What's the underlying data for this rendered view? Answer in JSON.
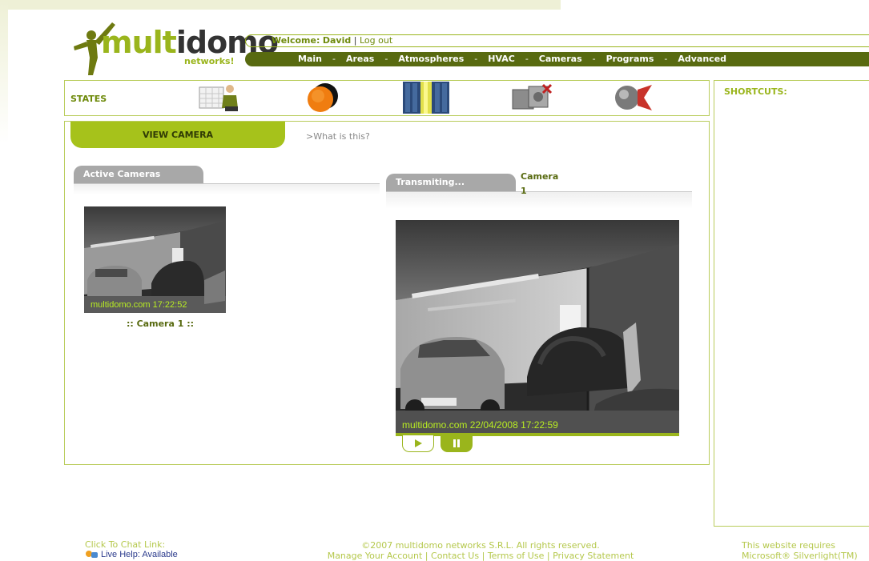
{
  "logo": {
    "part1": "mult",
    "part2": "idomo",
    "subtitle": "networks!"
  },
  "header": {
    "welcome_label": "Welcome:",
    "user_name": "David",
    "separator": "|",
    "logout": "Log out"
  },
  "nav": {
    "items": [
      "Main",
      "Areas",
      "Atmospheres",
      "HVAC",
      "Cameras",
      "Programs",
      "Advanced"
    ],
    "separator": "-"
  },
  "states": {
    "label": "STATES",
    "icons": [
      "calendar-person-icon",
      "sun-moon-icon",
      "blinds-icon",
      "projector-icon",
      "camera-globe-icon"
    ]
  },
  "shortcuts": {
    "label": "SHORTCUTS:"
  },
  "main": {
    "view_camera_tab": "VIEW CAMERA",
    "what_link": ">What is this?",
    "active_cameras_tab": "Active Cameras",
    "transmitting_tab": "Transmiting...",
    "camera_title_line1": "Camera",
    "camera_title_line2": "1",
    "thumb_stamp": "multidomo.com 17:22:52",
    "thumb_caption": ":: Camera 1 ::",
    "main_stamp": "multidomo.com 22/04/2008 17:22:59"
  },
  "footer": {
    "chat_label": "Click To Chat Link:",
    "live_help": "Live Help: Available",
    "copyright": "©2007 multidomo networks S.R.L. All rights reserved.",
    "links": [
      "Manage Your Account",
      "Contact Us",
      "Terms of Use",
      "Privacy Statement"
    ],
    "link_separator": "|",
    "requires_line1": "This website requires",
    "requires_line2": "Microsoft® Silverlight(TM)"
  },
  "colors": {
    "brand_green": "#9ab51c",
    "dark_olive": "#586a10",
    "tab_grey": "#a8a8a8"
  }
}
